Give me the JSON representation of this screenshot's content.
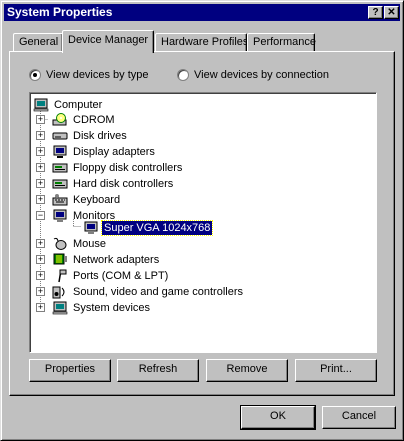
{
  "window": {
    "title": "System Properties",
    "help_glyph": "?",
    "close_glyph": "✕"
  },
  "tabs": [
    {
      "label": "General"
    },
    {
      "label": "Device Manager"
    },
    {
      "label": "Hardware Profiles"
    },
    {
      "label": "Performance"
    }
  ],
  "active_tab": "Device Manager",
  "view_options": {
    "by_type": "View devices by type",
    "by_connection": "View devices by connection",
    "selected": "by_type"
  },
  "tree": {
    "root": "Computer",
    "items": [
      {
        "label": "CDROM",
        "icon": "cdrom-icon",
        "expander": "+"
      },
      {
        "label": "Disk drives",
        "icon": "disk-drive-icon",
        "expander": "+"
      },
      {
        "label": "Display adapters",
        "icon": "display-adapter-icon",
        "expander": "+"
      },
      {
        "label": "Floppy disk controllers",
        "icon": "floppy-controller-icon",
        "expander": "+"
      },
      {
        "label": "Hard disk controllers",
        "icon": "hard-disk-controller-icon",
        "expander": "+"
      },
      {
        "label": "Keyboard",
        "icon": "keyboard-icon",
        "expander": "+"
      },
      {
        "label": "Monitors",
        "icon": "monitor-icon",
        "expander": "−"
      },
      {
        "label": "Super VGA 1024x768",
        "icon": "monitor-icon",
        "selected": true
      },
      {
        "label": "Mouse",
        "icon": "mouse-icon",
        "expander": "+"
      },
      {
        "label": "Network adapters",
        "icon": "network-adapter-icon",
        "expander": "+"
      },
      {
        "label": "Ports (COM & LPT)",
        "icon": "port-icon",
        "expander": "+"
      },
      {
        "label": "Sound, video and game controllers",
        "icon": "sound-icon",
        "expander": "+"
      },
      {
        "label": "System devices",
        "icon": "system-devices-icon",
        "expander": "+"
      }
    ]
  },
  "panel_buttons": {
    "properties": "Properties",
    "refresh": "Refresh",
    "remove": "Remove",
    "print": "Print..."
  },
  "dialog_buttons": {
    "ok": "OK",
    "cancel": "Cancel"
  }
}
